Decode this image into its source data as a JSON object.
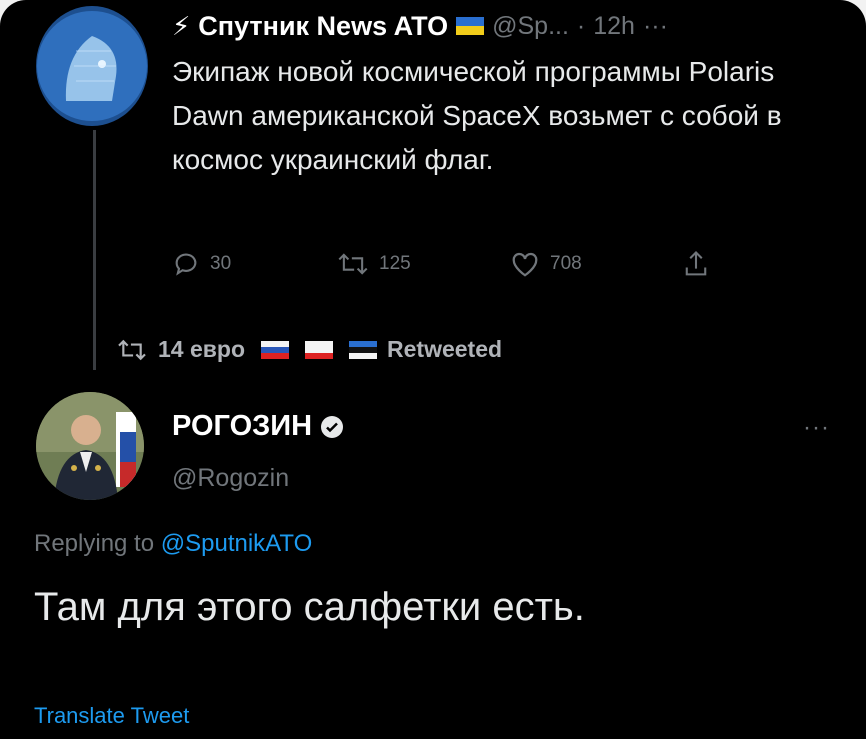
{
  "tweet1": {
    "display_name": "Спутник News ATO",
    "handle": "@Sp...",
    "time": "12h",
    "more_glyph": "···",
    "text": "Экипаж новой космической программы Polaris Dawn американской SpaceX возьмет с собой в космос украинский флаг.",
    "actions": {
      "replies": "30",
      "retweets": "125",
      "likes": "708"
    }
  },
  "retweet_banner": {
    "text": "14 евро",
    "suffix": "Retweeted"
  },
  "tweet2": {
    "display_name": "РОГОЗИН",
    "handle": "@Rogozin",
    "more_glyph": "···",
    "replying_prefix": "Replying to",
    "replying_mention": "@SputnikATO",
    "text": "Там для этого салфетки есть.",
    "translate": "Translate Tweet"
  },
  "colors": {
    "background": "#000000",
    "text": "#e7e9ea",
    "muted": "#71767b",
    "link": "#1d9bf0"
  }
}
